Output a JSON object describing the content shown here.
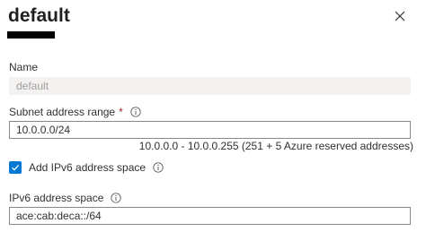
{
  "panel": {
    "title": "default"
  },
  "name_field": {
    "label": "Name",
    "value": "default"
  },
  "subnet_range": {
    "label": "Subnet address range",
    "required_marker": "*",
    "value": "10.0.0.0/24",
    "hint": "10.0.0.0 - 10.0.0.255 (251 + 5 Azure reserved addresses)"
  },
  "ipv6_checkbox": {
    "label": "Add IPv6 address space",
    "checked": true
  },
  "ipv6_space": {
    "label": "IPv6 address space",
    "value": "ace:cab:deca::/64"
  },
  "colors": {
    "accent": "#0078d4",
    "required": "#a4262c",
    "disabled_bg": "#f3f2f1"
  },
  "icons": {
    "close": "close-icon",
    "info": "info-icon",
    "check": "checkmark-icon"
  }
}
